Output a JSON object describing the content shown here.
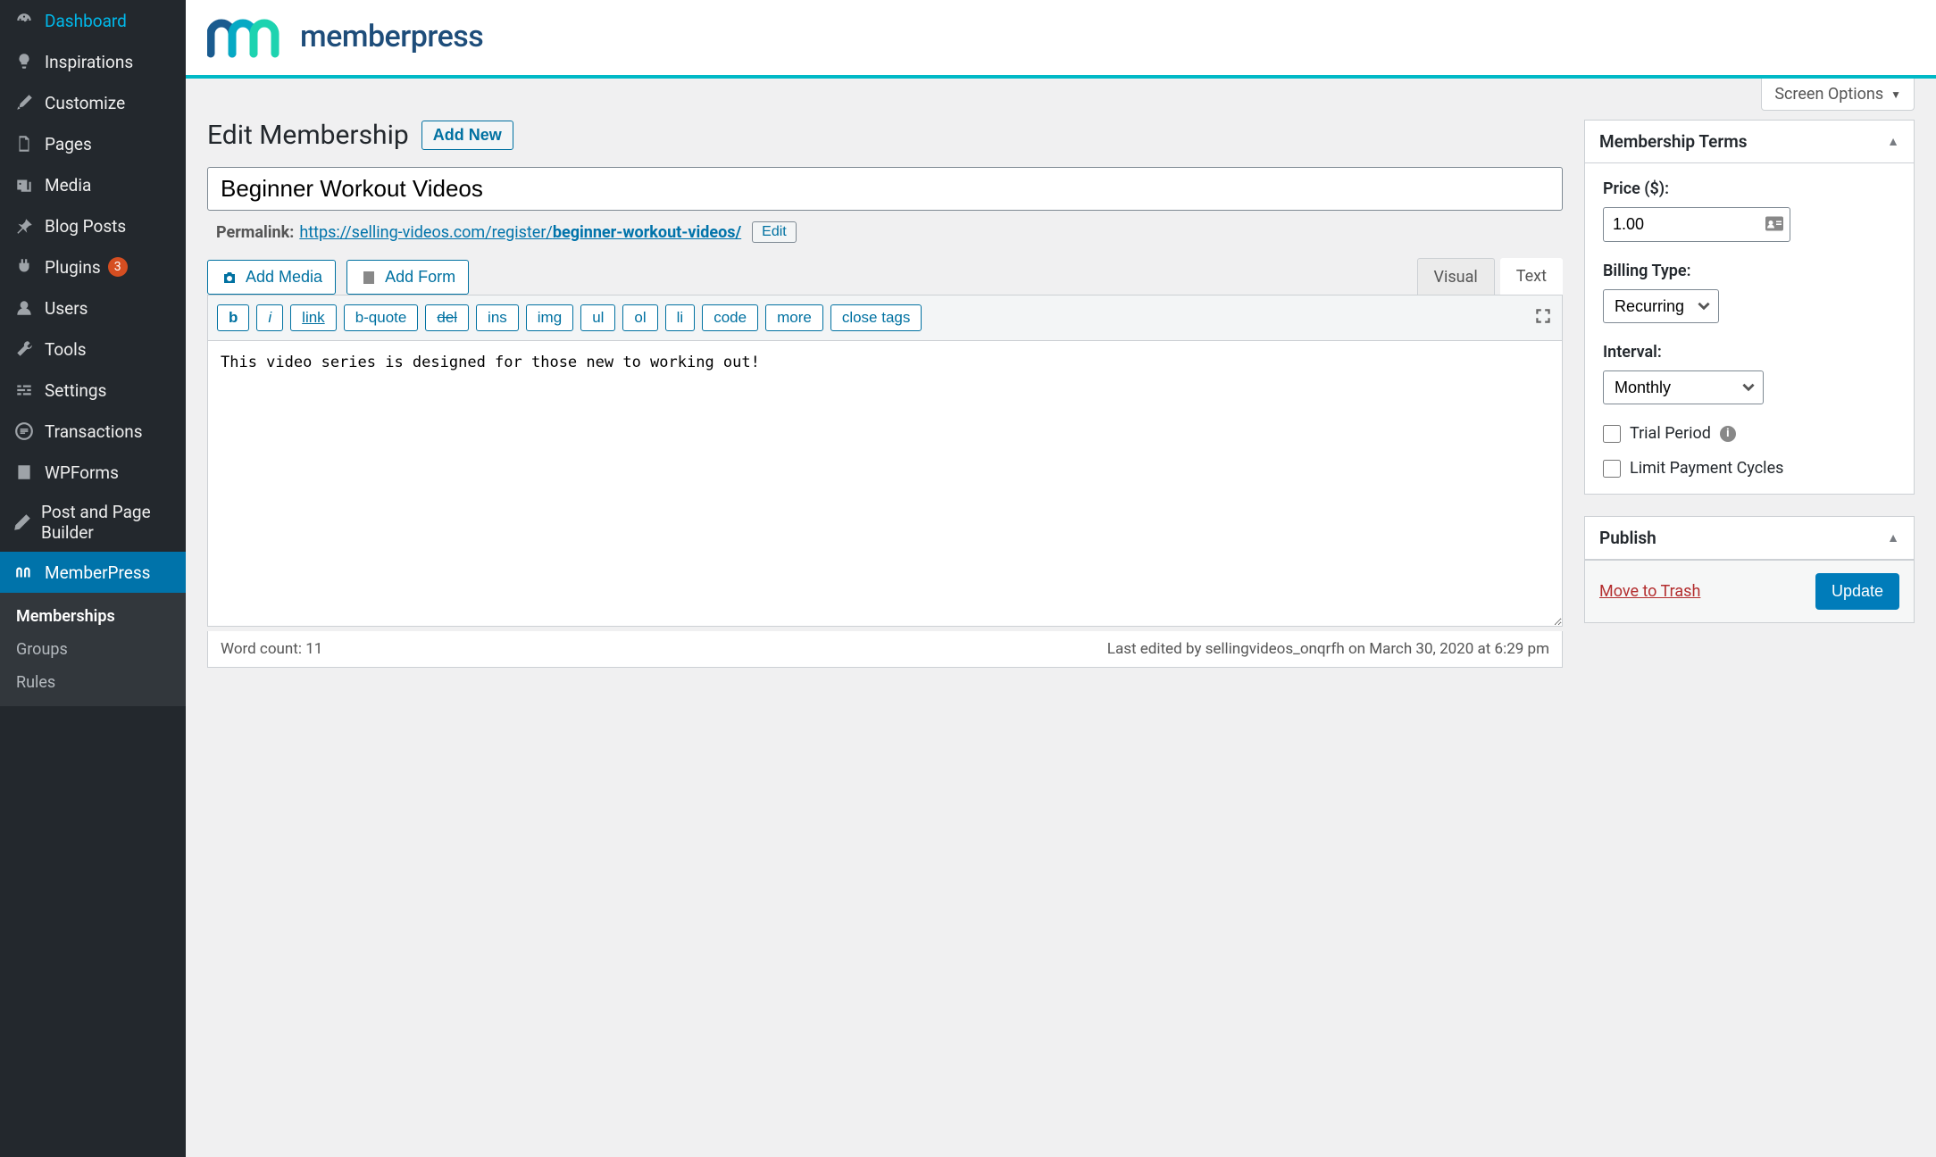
{
  "sidebar": {
    "items": [
      {
        "label": "Dashboard",
        "icon": "dashboard"
      },
      {
        "label": "Inspirations",
        "icon": "lightbulb"
      },
      {
        "label": "Customize",
        "icon": "brush"
      },
      {
        "label": "Pages",
        "icon": "pages"
      },
      {
        "label": "Media",
        "icon": "media"
      },
      {
        "label": "Blog Posts",
        "icon": "pin"
      },
      {
        "label": "Plugins",
        "icon": "plug",
        "badge": "3"
      },
      {
        "label": "Users",
        "icon": "user"
      },
      {
        "label": "Tools",
        "icon": "wrench"
      },
      {
        "label": "Settings",
        "icon": "sliders"
      },
      {
        "label": "Transactions",
        "icon": "list-circle"
      },
      {
        "label": "WPForms",
        "icon": "form"
      },
      {
        "label": "Post and Page Builder",
        "icon": "pencil"
      },
      {
        "label": "MemberPress",
        "icon": "mp"
      }
    ],
    "submenu": [
      {
        "label": "Memberships",
        "current": true
      },
      {
        "label": "Groups"
      },
      {
        "label": "Rules"
      }
    ]
  },
  "banner": {
    "brand": "memberpress"
  },
  "screenOptions": "Screen Options",
  "page": {
    "title": "Edit Membership",
    "addNew": "Add New",
    "titleValue": "Beginner Workout Videos",
    "permalinkLabel": "Permalink:",
    "permalinkBase": "https://selling-videos.com/register/",
    "permalinkSlug": "beginner-workout-videos/",
    "editBtn": "Edit",
    "addMedia": "Add Media",
    "addForm": "Add Form"
  },
  "editor": {
    "tabs": {
      "visual": "Visual",
      "text": "Text"
    },
    "buttons": [
      "b",
      "i",
      "link",
      "b-quote",
      "del",
      "ins",
      "img",
      "ul",
      "ol",
      "li",
      "code",
      "more",
      "close tags"
    ],
    "content": "This video series is designed for those new to working out!",
    "wordCountLabel": "Word count: ",
    "wordCount": "11",
    "lastEdited": "Last edited by sellingvideos_onqrfh on March 30, 2020 at 6:29 pm"
  },
  "terms": {
    "heading": "Membership Terms",
    "priceLabel": "Price ($):",
    "priceValue": "1.00",
    "billingLabel": "Billing Type:",
    "billingValue": "Recurring",
    "intervalLabel": "Interval:",
    "intervalValue": "Monthly",
    "trialLabel": "Trial Period",
    "limitLabel": "Limit Payment Cycles"
  },
  "publish": {
    "heading": "Publish",
    "trash": "Move to Trash",
    "update": "Update"
  }
}
